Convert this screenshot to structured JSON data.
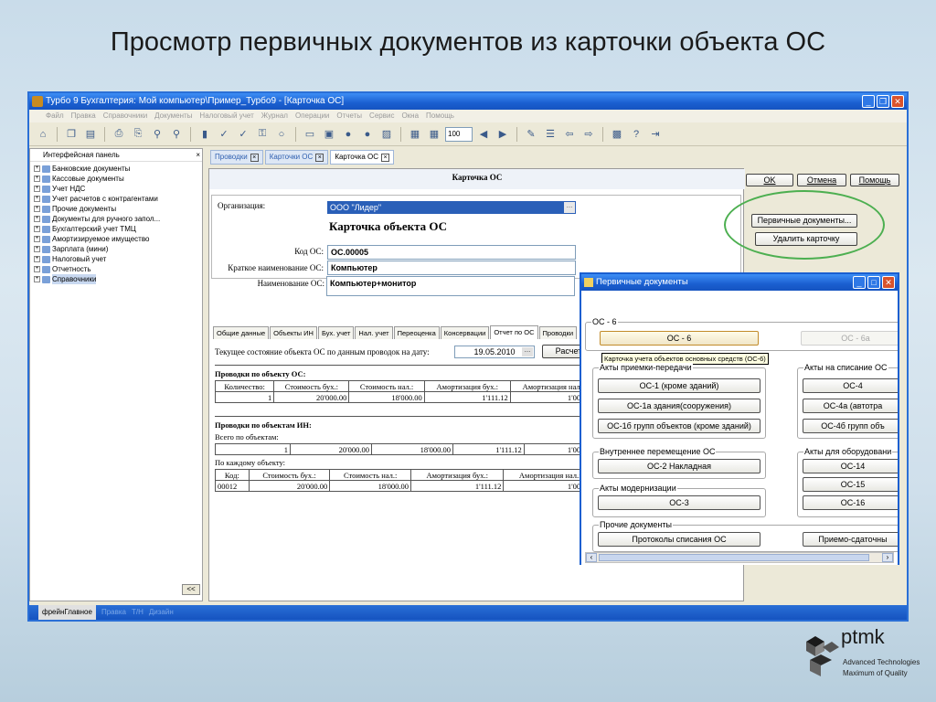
{
  "slide": {
    "title": "Просмотр первичных документов из карточки объекта ОС",
    "logo_name": "ptmk",
    "logo_tag1": "Advanced Technologies",
    "logo_tag2": "Maximum of Quality"
  },
  "window": {
    "title": "Турбо 9 Бухгалтерия: Мой компьютер\\Пример_Турбо9 - [Карточка ОС]",
    "menu": [
      "Файл",
      "Правка",
      "Справочники",
      "Документы",
      "Налоговый учет",
      "Журнал",
      "Операции",
      "Отчеты",
      "Сервис",
      "Окна",
      "Помощь"
    ],
    "zoom": "100"
  },
  "left_panel": {
    "title": "Интерфейсная панель",
    "collapse_label": "<<",
    "items": [
      "Банковские документы",
      "Кассовые документы",
      "Учет НДС",
      "Учет расчетов с контрагентами",
      "Прочие документы",
      "Документы для ручного запол...",
      "Бухгалтерский учет ТМЦ",
      "Амортизируемое имущество",
      "Зарплата (мини)",
      "Налоговый учет",
      "Отчетность",
      "Справочники"
    ]
  },
  "doc_tabs": [
    "Проводки",
    "Карточки ОС",
    "Карточка ОС"
  ],
  "card": {
    "header": "Карточка ОС",
    "ok_label": "OK",
    "cancel_label": "Отмена",
    "help_label": "Помощь",
    "org_label": "Организация:",
    "org_value": "ООО \"Лидер\"",
    "big_title": "Карточка объекта ОС",
    "code_label": "Код ОС:",
    "code_value": "ОС.00005",
    "short_name_label": "Краткое наименование ОС:",
    "short_name_value": "Компьютер",
    "name_label": "Наименование ОС:",
    "name_value": "Компьютер+монитор",
    "subtabs": [
      "Общие данные",
      "Объекты ИН",
      "Бух. учет",
      "Нал. учет",
      "Переоценка",
      "Консервации",
      "Отчет по ОС",
      "Проводки"
    ],
    "date_label": "Текущее состояние объекта ОС по данным проводок на дату:",
    "date_value": "19.05.2010",
    "calc_label": "Расчет",
    "sec1_title": "Проводки по объекту ОС:",
    "sec1_headers": [
      "Количество:",
      "Стоимость бух.:",
      "Стоимость нал.:",
      "Амортизация бух.:",
      "Амортизация нал.:"
    ],
    "sec1_row": [
      "1",
      "20'000.00",
      "18'000.00",
      "1'111.12",
      "1'000.00"
    ],
    "sec2_title": "Проводки по объектам ИН:",
    "sec2_total_label": "Всего по объектам:",
    "sec2_total_row": [
      "1",
      "20'000.00",
      "18'000.00",
      "1'111.12",
      "1'000.00"
    ],
    "sec2_each_label": "По каждому объекту:",
    "sec2_headers": [
      "Код:",
      "Стоимость бух.:",
      "Стоимость нал.:",
      "Амортизация бух.:",
      "Амортизация нал.:"
    ],
    "sec2_row": [
      "00012",
      "20'000.00",
      "18'000.00",
      "1'111.12",
      "1'000.00"
    ],
    "primary_docs_label": "Первичные документы...",
    "delete_card_label": "Удалить карточку"
  },
  "popup": {
    "title": "Первичные документы",
    "grp_os6": "ОС - 6",
    "btn_os6": "ОС - 6",
    "btn_os6a": "ОС - 6а",
    "tooltip": "Карточка учета объектов основных средств (ОС-6)",
    "grp_accept": "Акты приемки-передачи",
    "btn_os1": "ОС-1 (кроме зданий)",
    "btn_os1a": "ОС-1а здания(сооружения)",
    "btn_os1b": "ОС-1б групп объектов (кроме зданий)",
    "grp_writeoff": "Акты на списание ОС",
    "btn_os4": "ОС-4",
    "btn_os4a": "ОС-4а (автотра",
    "btn_os4b": "ОС-4б групп объ",
    "grp_move": "Внутреннее перемещение ОС",
    "btn_os2": "ОС-2 Накладная",
    "grp_equip": "Акты для оборудовани",
    "btn_os14": "ОС-14",
    "btn_os15": "ОС-15",
    "btn_os16": "ОС-16",
    "grp_modern": "Акты модернизации",
    "btn_os3": "ОС-3",
    "grp_other": "Прочие документы",
    "btn_protocols": "Протоколы списания ОС",
    "btn_accept_deliv": "Приемо-сдаточны"
  },
  "statusbar": [
    "фрейнГлавное",
    "Правка",
    "Т/Н",
    "Дизайн"
  ],
  "colors": {
    "title_bar": "#1a5fd0",
    "highlight": "#4caf50",
    "frame": "#2a6fd6"
  }
}
